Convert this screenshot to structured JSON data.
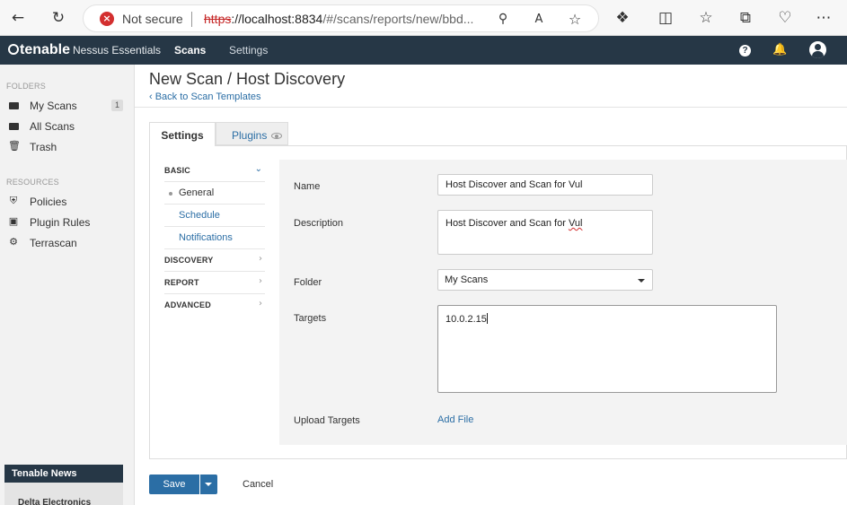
{
  "browser": {
    "security_label": "Not secure",
    "url_scheme": "https",
    "url_host": "://localhost:8834",
    "url_path": "/#/scans/reports/new/bbd..."
  },
  "header": {
    "brand": "tenable",
    "product": "Nessus Essentials",
    "nav": [
      "Scans",
      "Settings"
    ]
  },
  "sidebar": {
    "folders_heading": "FOLDERS",
    "folders": [
      {
        "label": "My Scans",
        "count": "1"
      },
      {
        "label": "All Scans"
      },
      {
        "label": "Trash"
      }
    ],
    "resources_heading": "RESOURCES",
    "resources": [
      {
        "label": "Policies"
      },
      {
        "label": "Plugin Rules"
      },
      {
        "label": "Terrascan"
      }
    ],
    "news_heading": "Tenable News",
    "news_item": "Delta Electronics"
  },
  "page": {
    "title": "New Scan / Host Discovery",
    "back_link": "‹ Back to Scan Templates",
    "tabs": [
      "Settings",
      "Plugins"
    ]
  },
  "subnav": {
    "basic": "BASIC",
    "basic_items": [
      "General",
      "Schedule",
      "Notifications"
    ],
    "discovery": "DISCOVERY",
    "report": "REPORT",
    "advanced": "ADVANCED"
  },
  "form": {
    "name_label": "Name",
    "name_value": "Host Discover and Scan for Vul",
    "description_label": "Description",
    "description_prefix": "Host Discover and Scan for ",
    "description_misspelled": "Vul",
    "folder_label": "Folder",
    "folder_value": "My Scans",
    "targets_label": "Targets",
    "targets_value": "10.0.2.15",
    "upload_label": "Upload Targets",
    "add_file": "Add File"
  },
  "actions": {
    "save": "Save",
    "cancel": "Cancel"
  },
  "colors": {
    "header_bg": "#263746",
    "link": "#2b6ea5",
    "primary_button": "#2b6ea5"
  }
}
